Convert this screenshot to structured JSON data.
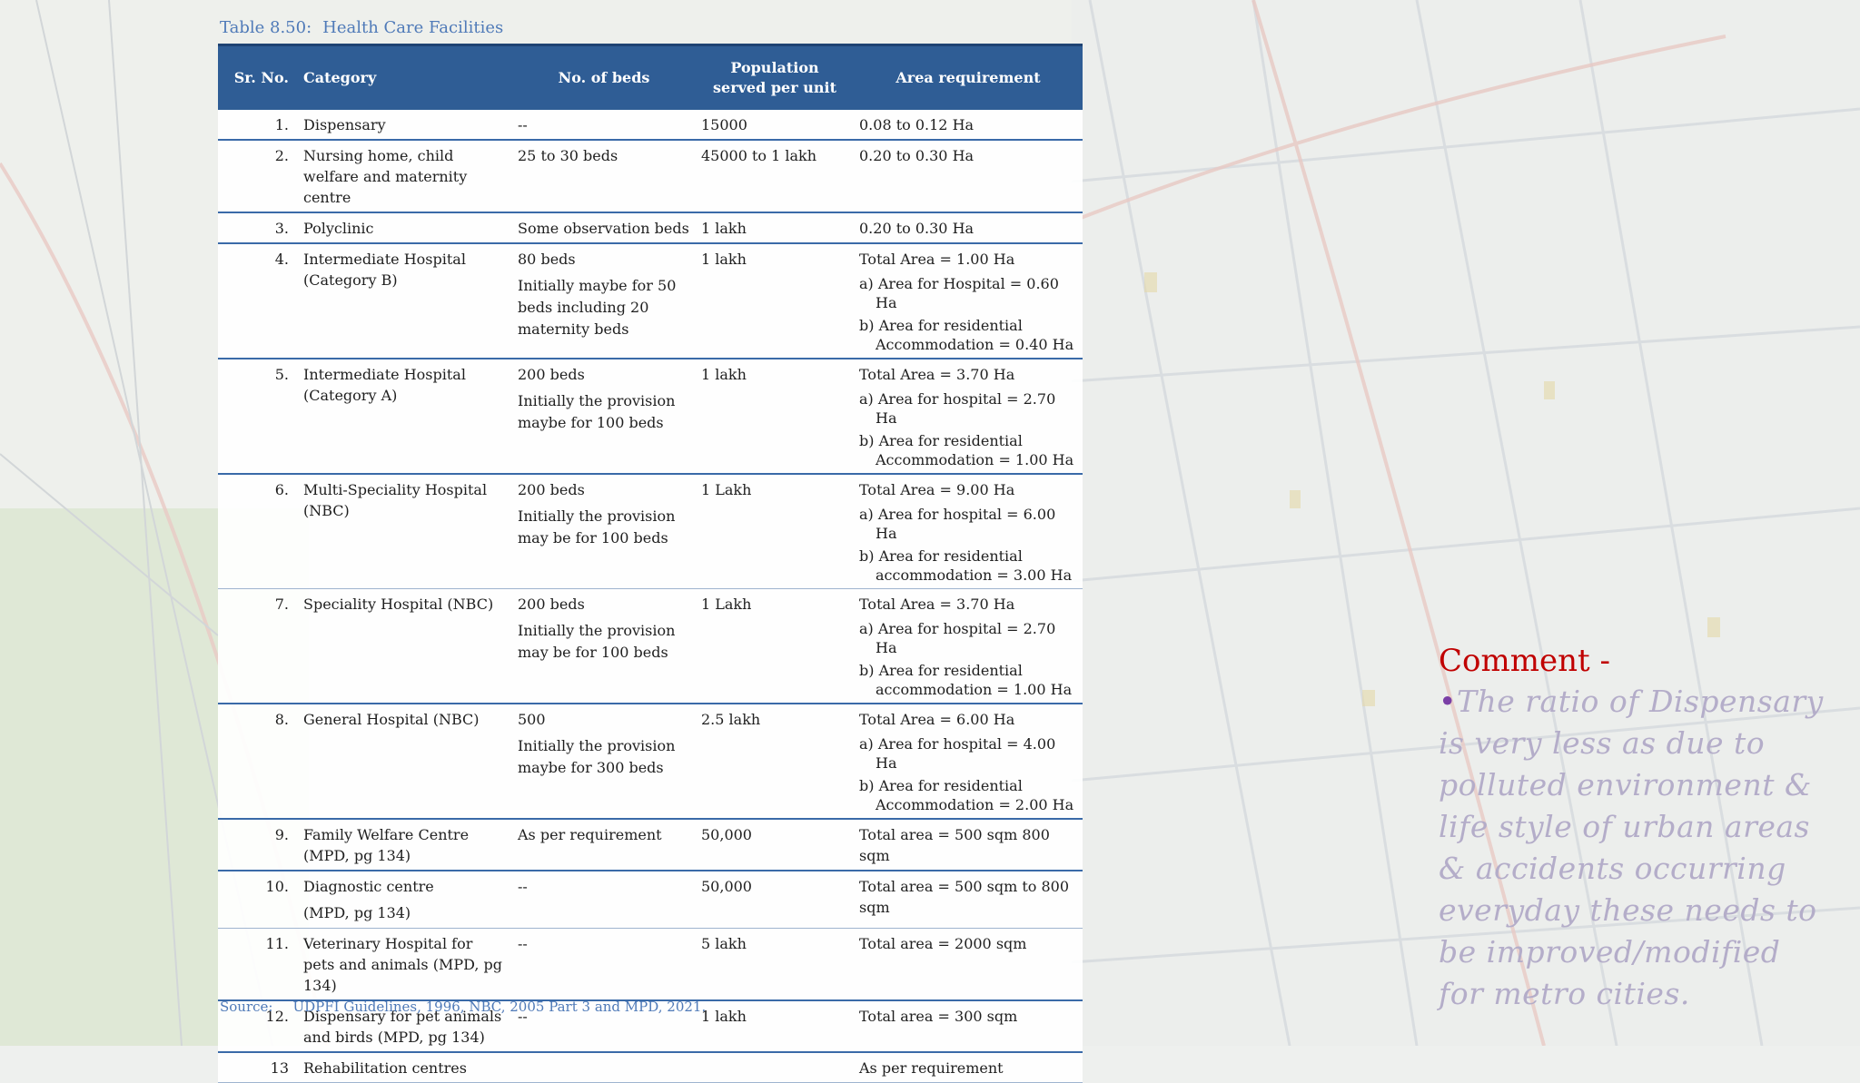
{
  "table": {
    "caption_number": "Table 8.50:",
    "caption_title": "Health Care Facilities",
    "headers": {
      "sr_no": "Sr. No.",
      "category": "Category",
      "beds": "No. of beds",
      "population_1": "Population",
      "population_2": "served per unit",
      "area": "Area requirement"
    },
    "rows": [
      {
        "sr": "1.",
        "category": "Dispensary",
        "beds": "--",
        "beds_note": "",
        "population": "15000",
        "area_total": "0.08 to 0.12 Ha",
        "area_a": "",
        "area_b": ""
      },
      {
        "sr": "2.",
        "category": "Nursing home, child welfare and maternity centre",
        "beds": "25 to 30 beds",
        "beds_note": "",
        "population": "45000 to 1 lakh",
        "area_total": "0.20 to 0.30 Ha",
        "area_a": "",
        "area_b": ""
      },
      {
        "sr": "3.",
        "category": "Polyclinic",
        "beds": "Some observation beds",
        "beds_note": "",
        "population": "1 lakh",
        "area_total": "0.20 to 0.30 Ha",
        "area_a": "",
        "area_b": ""
      },
      {
        "sr": "4.",
        "category": "Intermediate Hospital (Category B)",
        "beds": "80 beds",
        "beds_note": "Initially maybe for 50 beds including 20 maternity beds",
        "population": "1 lakh",
        "area_total": "Total Area = 1.00 Ha",
        "area_a": "a) Area for Hospital = 0.60 Ha",
        "area_b": "b) Area for residential Accommodation = 0.40 Ha"
      },
      {
        "sr": "5.",
        "category": "Intermediate Hospital (Category A)",
        "beds": "200 beds",
        "beds_note": "Initially the provision maybe for 100 beds",
        "population": "1 lakh",
        "area_total": "Total Area = 3.70 Ha",
        "area_a": "a) Area for hospital = 2.70 Ha",
        "area_b": "b) Area for residential Accommodation = 1.00 Ha"
      },
      {
        "sr": "6.",
        "category": "Multi-Speciality Hospital (NBC)",
        "beds": "200 beds",
        "beds_note": "Initially the provision may be for 100 beds",
        "population": "1 Lakh",
        "area_total": "Total Area = 9.00 Ha",
        "area_a": "a) Area for hospital = 6.00 Ha",
        "area_b": "b) Area for residential accommodation = 3.00 Ha"
      },
      {
        "sr": "7.",
        "category": "Speciality Hospital (NBC)",
        "beds": "200 beds",
        "beds_note": "Initially the provision may be for 100 beds",
        "population": "1 Lakh",
        "area_total": "Total Area = 3.70 Ha",
        "area_a": "a) Area for hospital = 2.70 Ha",
        "area_b": "b) Area for residential accommodation = 1.00 Ha"
      },
      {
        "sr": "8.",
        "category": "General Hospital (NBC)",
        "beds": "500",
        "beds_note": "Initially the provision maybe for 300 beds",
        "population": "2.5 lakh",
        "area_total": "Total Area = 6.00 Ha",
        "area_a": "a) Area for hospital = 4.00 Ha",
        "area_b": "b) Area for residential Accommodation = 2.00 Ha"
      },
      {
        "sr": "9.",
        "category": "Family Welfare Centre (MPD, pg 134)",
        "beds": "As per requirement",
        "beds_note": "",
        "population": "50,000",
        "area_total": "Total area = 500 sqm 800 sqm",
        "area_a": "",
        "area_b": ""
      },
      {
        "sr": "10.",
        "category": "Diagnostic centre",
        "category_note": "(MPD, pg 134)",
        "beds": "--",
        "beds_note": "",
        "population": "50,000",
        "area_total": "Total area = 500 sqm to 800 sqm",
        "area_a": "",
        "area_b": ""
      },
      {
        "sr": "11.",
        "category": "Veterinary Hospital for pets and animals (MPD, pg 134)",
        "beds": "--",
        "beds_note": "",
        "population": "5 lakh",
        "area_total": "Total area = 2000 sqm",
        "area_a": "",
        "area_b": ""
      },
      {
        "sr": "12.",
        "category": "Dispensary for pet animals and birds (MPD, pg 134)",
        "beds": "--",
        "beds_note": "",
        "population": "1 lakh",
        "area_total": "Total area = 300 sqm",
        "area_a": "",
        "area_b": ""
      },
      {
        "sr": "13",
        "category": "Rehabilitation centres",
        "beds": "",
        "beds_note": "",
        "population": "",
        "area_total": "As per requirement",
        "area_a": "",
        "area_b": ""
      }
    ],
    "source_label": "Source:",
    "source_text": "UDPFI Guidelines, 1996, NBC, 2005 Part 3 and MPD, 2021."
  },
  "comment": {
    "title": "Comment -",
    "bullet": "•",
    "text": "The ratio of Dispensary is very less as due to polluted environment & life  style of urban areas & accidents occurring everyday these needs to be improved/modified for metro cities."
  },
  "colors": {
    "header_bg": "#2f5d95",
    "caption": "#4f7ab8",
    "comment_title": "#c00000",
    "comment_text": "#b4adc9"
  }
}
